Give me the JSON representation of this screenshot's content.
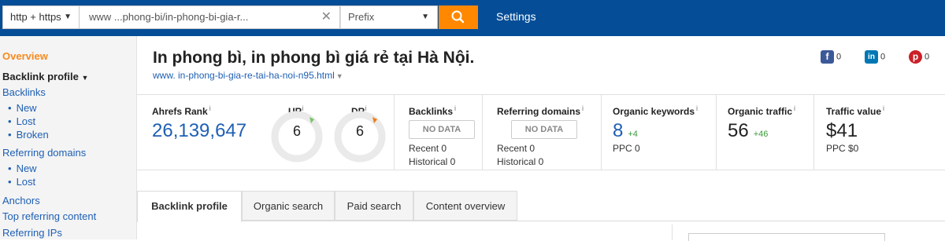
{
  "topbar": {
    "protocol": "http + https",
    "url_value": "www                       ...phong-bi/in-phong-bi-gia-r...",
    "mode": "Prefix",
    "settings_label": "Settings",
    "brand_color": "#054d97",
    "accent_color": "#ff8800"
  },
  "sidebar": {
    "overview": "Overview",
    "backlink_profile": "Backlink profile",
    "backlinks": "Backlinks",
    "backlinks_sub": [
      "New",
      "Lost",
      "Broken"
    ],
    "referring_domains": "Referring domains",
    "referring_sub": [
      "New",
      "Lost"
    ],
    "anchors": "Anchors",
    "top_referring_content": "Top referring content",
    "referring_ips": "Referring IPs"
  },
  "header": {
    "title": "In phong bì, in phong bì giá rẻ tại Hà Nội.",
    "url": "www.                                         in-phong-bi-gia-re-tai-ha-noi-n95.html",
    "social": [
      {
        "icon": "facebook-icon",
        "glyph": "f",
        "count": "0",
        "color": "#3b5998"
      },
      {
        "icon": "linkedin-icon",
        "glyph": "in",
        "count": "0",
        "color": "#0077b5"
      },
      {
        "icon": "pinterest-icon",
        "glyph": "p",
        "count": "0",
        "color": "#cb2027"
      }
    ]
  },
  "metrics": {
    "ahrefs_rank": {
      "label": "Ahrefs Rank",
      "value": "26,139,647"
    },
    "ur": {
      "label": "UR",
      "value": "6",
      "level": 6
    },
    "dr": {
      "label": "DR",
      "value": "6",
      "level": 6
    },
    "backlinks": {
      "label": "Backlinks",
      "value": "NO DATA",
      "recent": "Recent 0",
      "historical": "Historical 0"
    },
    "referring_domains": {
      "label": "Referring domains",
      "value": "NO DATA",
      "recent": "Recent 0",
      "historical": "Historical 0"
    },
    "organic_keywords": {
      "label": "Organic keywords",
      "value": "8",
      "delta": "+4",
      "sub": "PPC 0"
    },
    "organic_traffic": {
      "label": "Organic traffic",
      "value": "56",
      "delta": "+46"
    },
    "traffic_value": {
      "label": "Traffic value",
      "value": "$41",
      "sub": "PPC $0"
    },
    "info_mark": "i"
  },
  "tabs": [
    {
      "label": "Backlink profile",
      "active": true
    },
    {
      "label": "Organic search",
      "active": false
    },
    {
      "label": "Paid search",
      "active": false
    },
    {
      "label": "Content overview",
      "active": false
    }
  ]
}
